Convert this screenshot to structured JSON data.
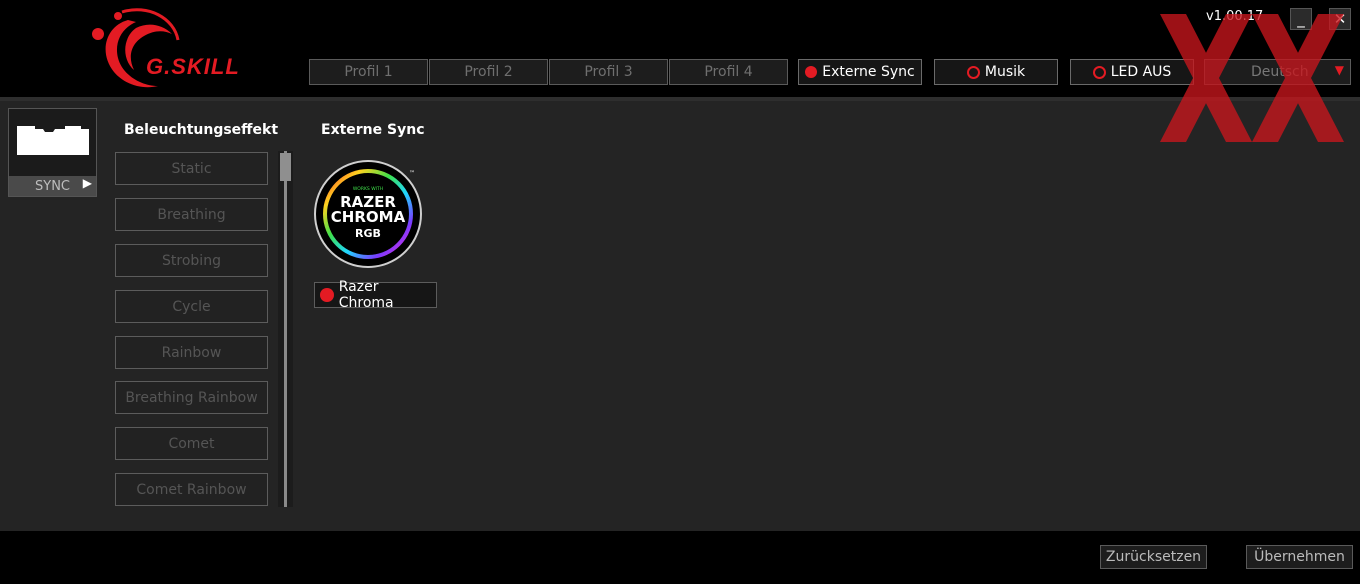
{
  "app": {
    "logo_text": "G.SKILL",
    "version": "v1.00.17",
    "minimize_symbol": "_",
    "close_symbol": "✕"
  },
  "nav": {
    "tabs": [
      {
        "label": "Profil 1"
      },
      {
        "label": "Profil 2"
      },
      {
        "label": "Profil 3"
      },
      {
        "label": "Profil 4"
      },
      {
        "label": "Externe Sync",
        "active": true
      },
      {
        "label": "Musik"
      },
      {
        "label": "LED AUS"
      }
    ],
    "language": "Deutsch"
  },
  "device": {
    "label": "SYNC"
  },
  "effects": {
    "title": "Beleuchtungseffekt",
    "items": [
      "Static",
      "Breathing",
      "Strobing",
      "Cycle",
      "Rainbow",
      "Breathing Rainbow",
      "Comet",
      "Comet Rainbow"
    ]
  },
  "sync": {
    "title": "Externe Sync",
    "badge_line1": "WORKS WITH",
    "badge_line2": "RAZER",
    "badge_line3": "CHROMA",
    "badge_line4": "RGB",
    "badge_tm": "™",
    "option_label": "Razer Chroma"
  },
  "footer": {
    "reset_label": "Zurücksetzen",
    "apply_label": "Übernehmen"
  },
  "colors": {
    "accent": "#e31b23",
    "background": "#242424",
    "header": "#000000"
  }
}
